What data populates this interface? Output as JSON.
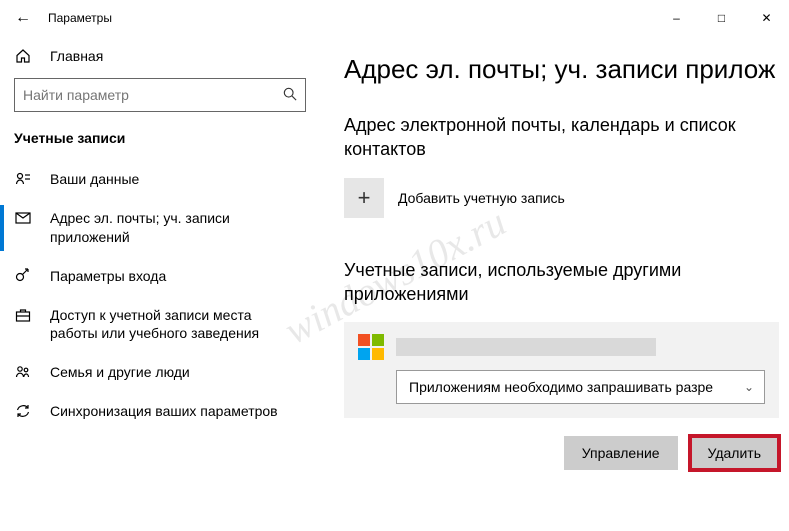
{
  "window": {
    "title": "Параметры"
  },
  "sidebar": {
    "home": "Главная",
    "search_placeholder": "Найти параметр",
    "section": "Учетные записи",
    "items": [
      {
        "label": "Ваши данные"
      },
      {
        "label": "Адрес эл. почты; уч. записи приложений"
      },
      {
        "label": "Параметры входа"
      },
      {
        "label": "Доступ к учетной записи места работы или учебного заведения"
      },
      {
        "label": "Семья и другие люди"
      },
      {
        "label": "Синхронизация ваших параметров"
      }
    ]
  },
  "content": {
    "heading": "Адрес эл. почты; уч. записи прилож",
    "sec1_title": "Адрес электронной почты, календарь и список контактов",
    "add_label": "Добавить учетную запись",
    "sec2_title": "Учетные записи, используемые другими приложениями",
    "perm_option": "Приложениям необходимо запрашивать разре",
    "btn_manage": "Управление",
    "btn_delete": "Удалить"
  },
  "watermark": "windows10x.ru"
}
